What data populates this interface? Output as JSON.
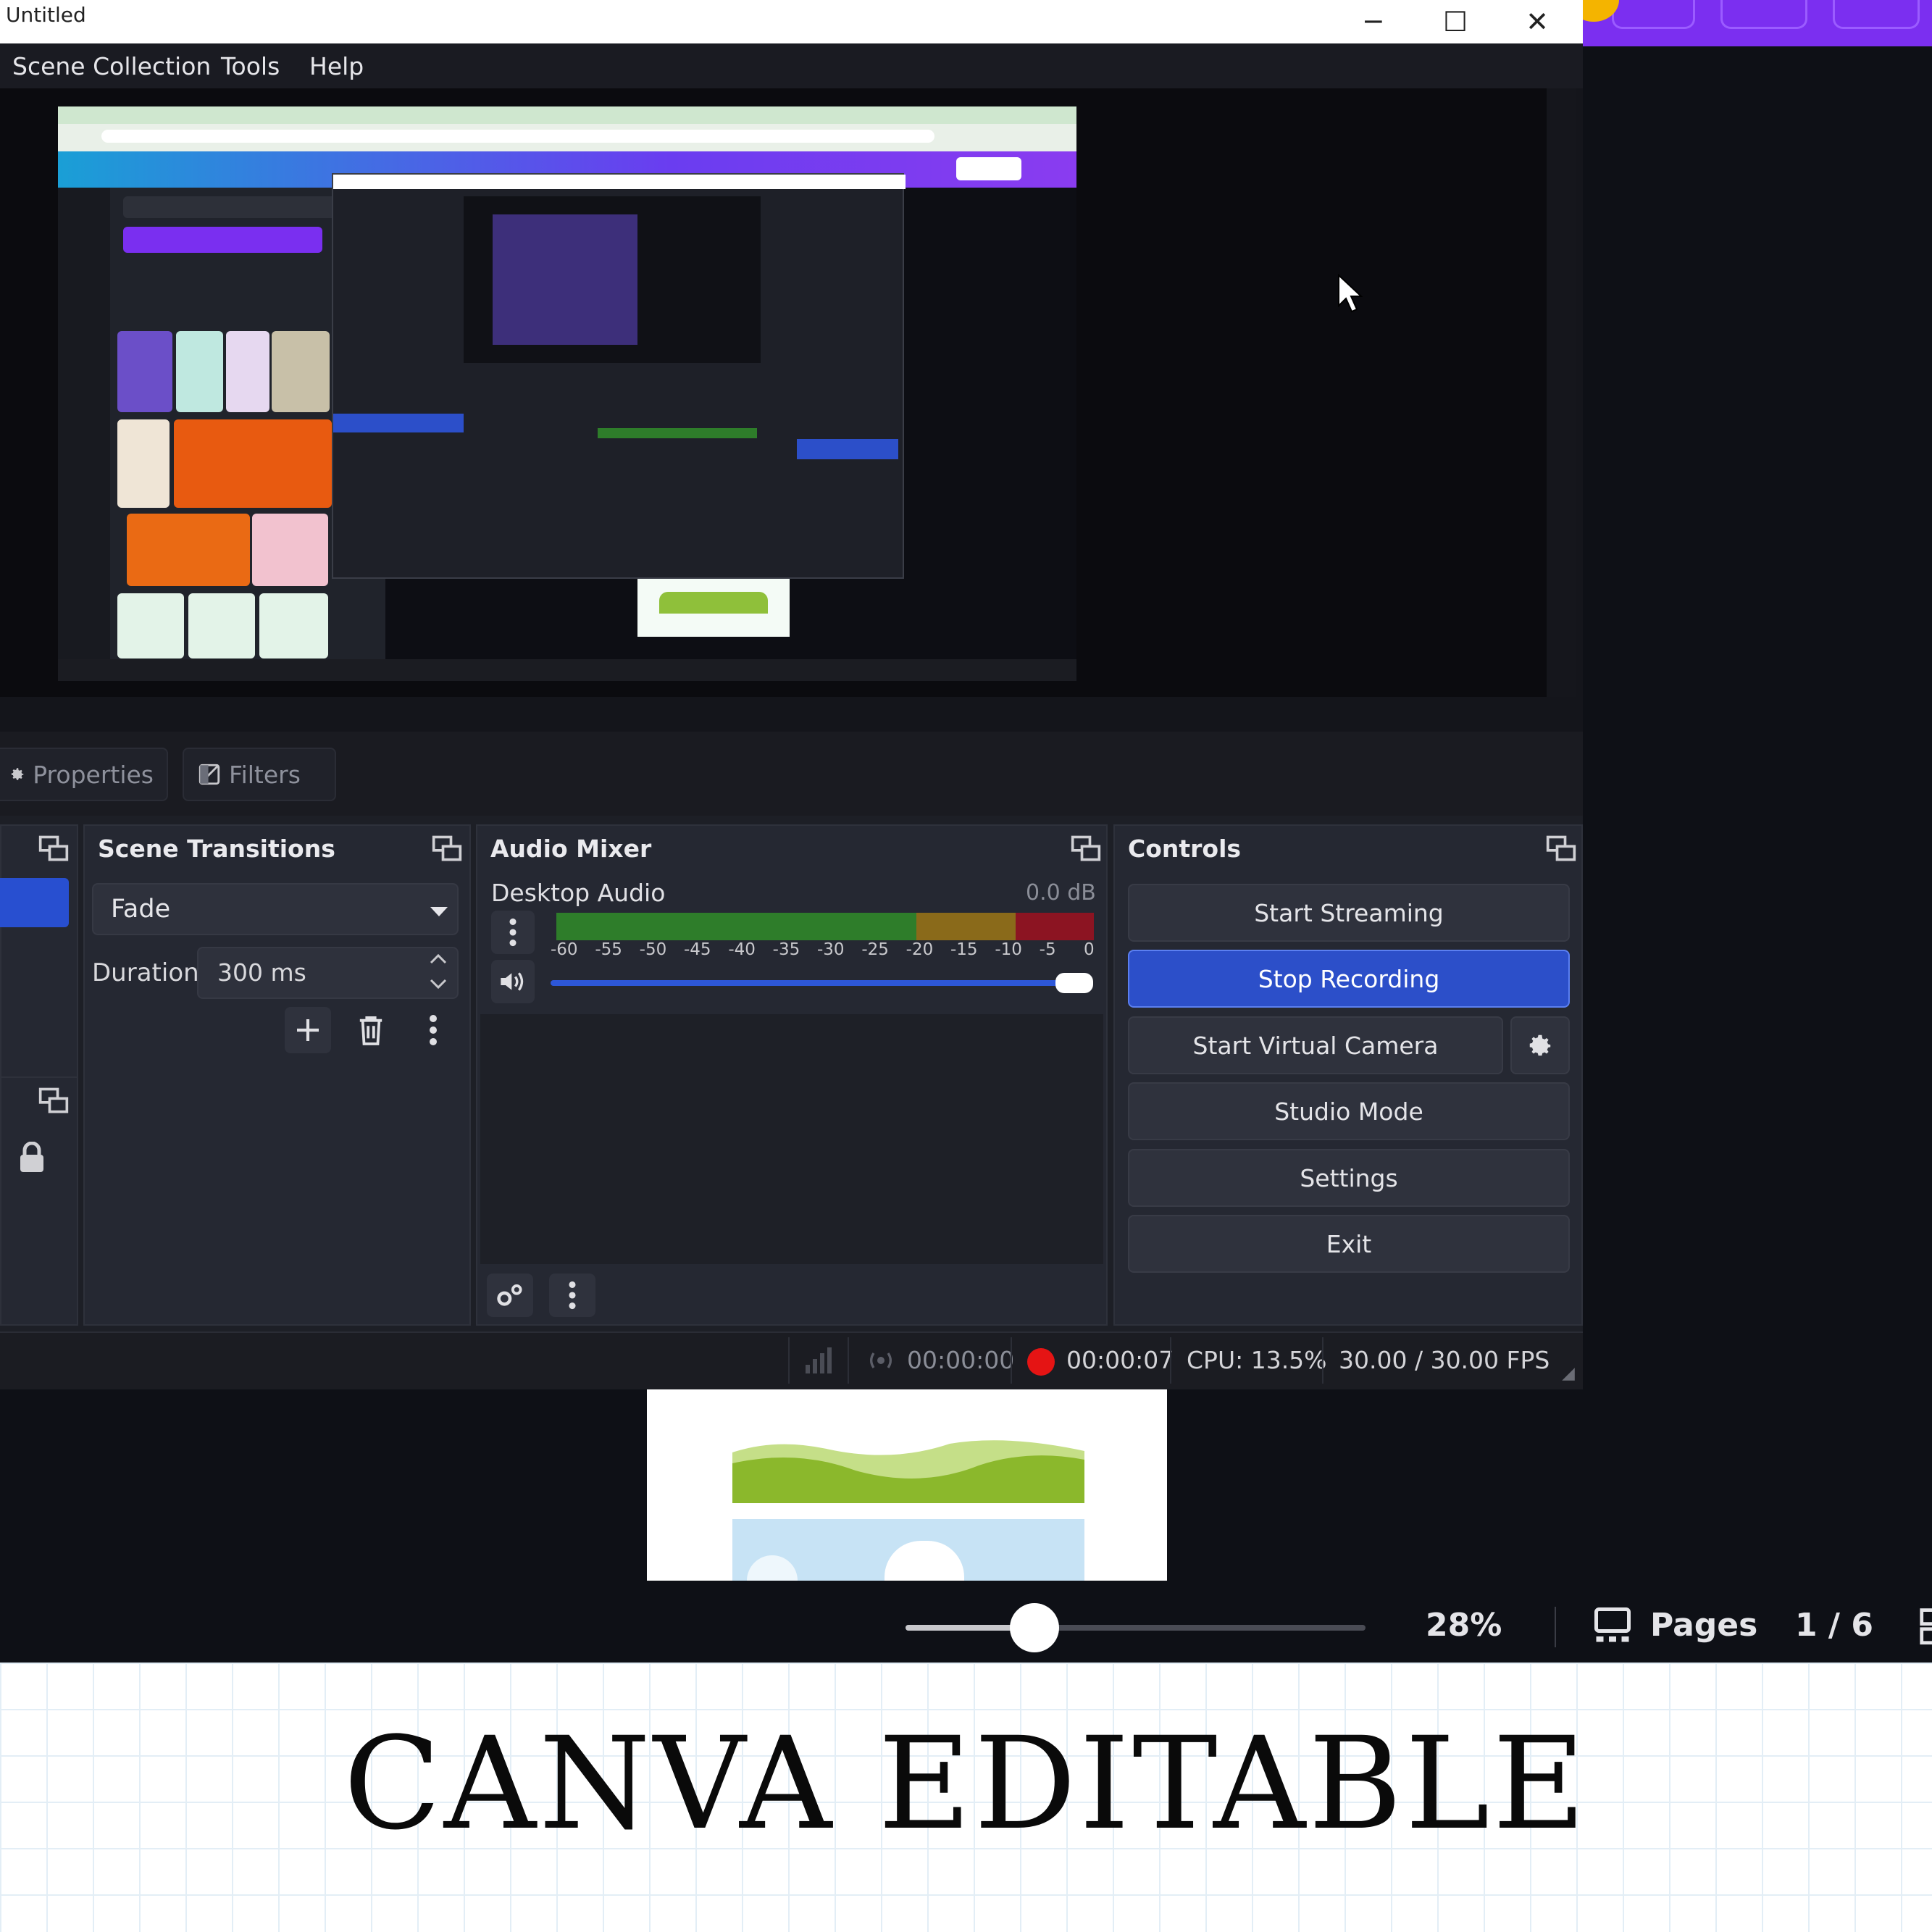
{
  "window": {
    "title": "Untitled",
    "minimize_glyph": "─",
    "maximize_glyph": "☐",
    "close_glyph": "✕"
  },
  "menu": {
    "items": [
      "Scene Collection",
      "Tools",
      "Help"
    ]
  },
  "dock_tabs": {
    "properties": "Properties",
    "filters": "Filters"
  },
  "transitions": {
    "title": "Scene Transitions",
    "selected": "Fade",
    "duration_label": "Duration",
    "duration_value": "300 ms"
  },
  "mixer": {
    "title": "Audio Mixer",
    "channel": "Desktop Audio",
    "level": "0.0 dB",
    "ticks": [
      "-60",
      "-55",
      "-50",
      "-45",
      "-40",
      "-35",
      "-30",
      "-25",
      "-20",
      "-15",
      "-10",
      "-5",
      "0"
    ],
    "volume_fraction": 1.0
  },
  "controls": {
    "title": "Controls",
    "start_streaming": "Start Streaming",
    "stop_recording": "Stop Recording",
    "start_virtual_camera": "Start Virtual Camera",
    "studio_mode": "Studio Mode",
    "settings": "Settings",
    "exit": "Exit"
  },
  "status": {
    "stream_time": "00:00:00",
    "rec_time": "00:00:07",
    "cpu": "CPU: 13.5%",
    "fps": "30.00 / 30.00 FPS"
  },
  "canva": {
    "zoom": "28%",
    "pages_label": "Pages",
    "page_count": "1 / 6",
    "zoom_fraction": 0.28
  },
  "banner": {
    "text": "CANVA EDITABLE"
  },
  "colors": {
    "accent_blue": "#2c4fc9",
    "canva_purple": "#7b2ff0",
    "rec_red": "#e51414"
  }
}
